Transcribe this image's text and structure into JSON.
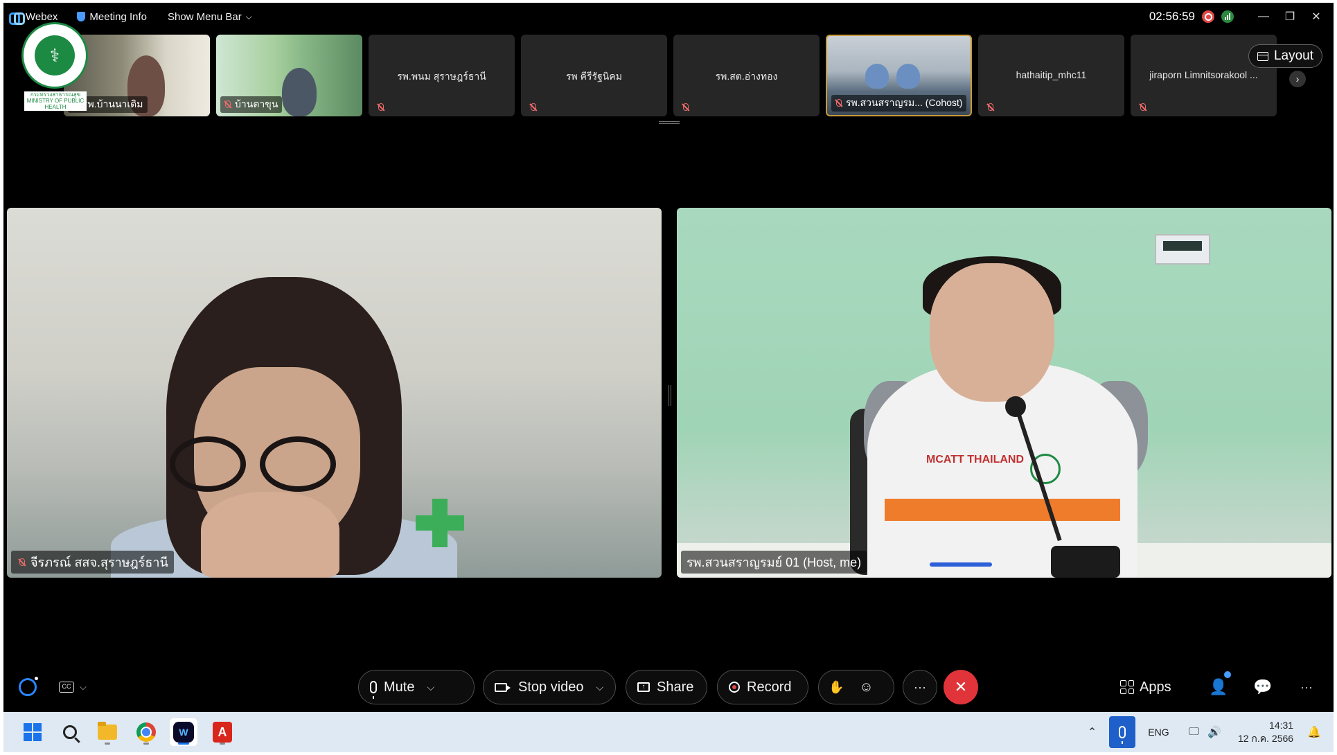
{
  "titlebar": {
    "app_name": "Webex",
    "meeting_info": "Meeting Info",
    "show_menu_bar": "Show Menu Bar",
    "timer": "02:56:59",
    "minimize": "—",
    "restore": "❐",
    "close": "✕"
  },
  "logo": {
    "caption": "กระทรวงสาธารณสุข MINISTRY OF PUBLIC HEALTH"
  },
  "thumbnails": [
    {
      "name": "รพ.บ้านนาเดิม",
      "video": true,
      "muted": true
    },
    {
      "name": "บ้านตาขุน",
      "video": true,
      "muted": true
    },
    {
      "name": "รพ.พนม สุราษฎร์ธานี",
      "video": false,
      "muted": true
    },
    {
      "name": "รพ คีรีรัฐนิคม",
      "video": false,
      "muted": true
    },
    {
      "name": "รพ.สต.อ่างทอง",
      "video": false,
      "muted": true
    },
    {
      "name": "รพ.สวนสราญรม... (Cohost)",
      "video": true,
      "muted": true
    },
    {
      "name": "hathaitip_mhc11",
      "video": false,
      "muted": true
    },
    {
      "name": "jiraporn Limnitsorakool ...",
      "video": false,
      "muted": true
    }
  ],
  "layout_button": "Layout",
  "stage": {
    "left_name": "จีรภรณ์ สสจ.สุราษฎร์ธานี",
    "right_name": "รพ.สวนสราญรมย์ 01 (Host, me)",
    "right_badge": "MCATT THAILAND"
  },
  "toolbar": {
    "mute": "Mute",
    "stop_video": "Stop video",
    "share": "Share",
    "record": "Record",
    "apps": "Apps",
    "more": "···",
    "end": "✕"
  },
  "taskbar": {
    "language": "ENG",
    "time": "14:31",
    "date": "12 ก.ค. 2566"
  },
  "colors": {
    "end_call": "#e0343a",
    "accent": "#1a73e8",
    "mute_red": "#f06a6a"
  }
}
